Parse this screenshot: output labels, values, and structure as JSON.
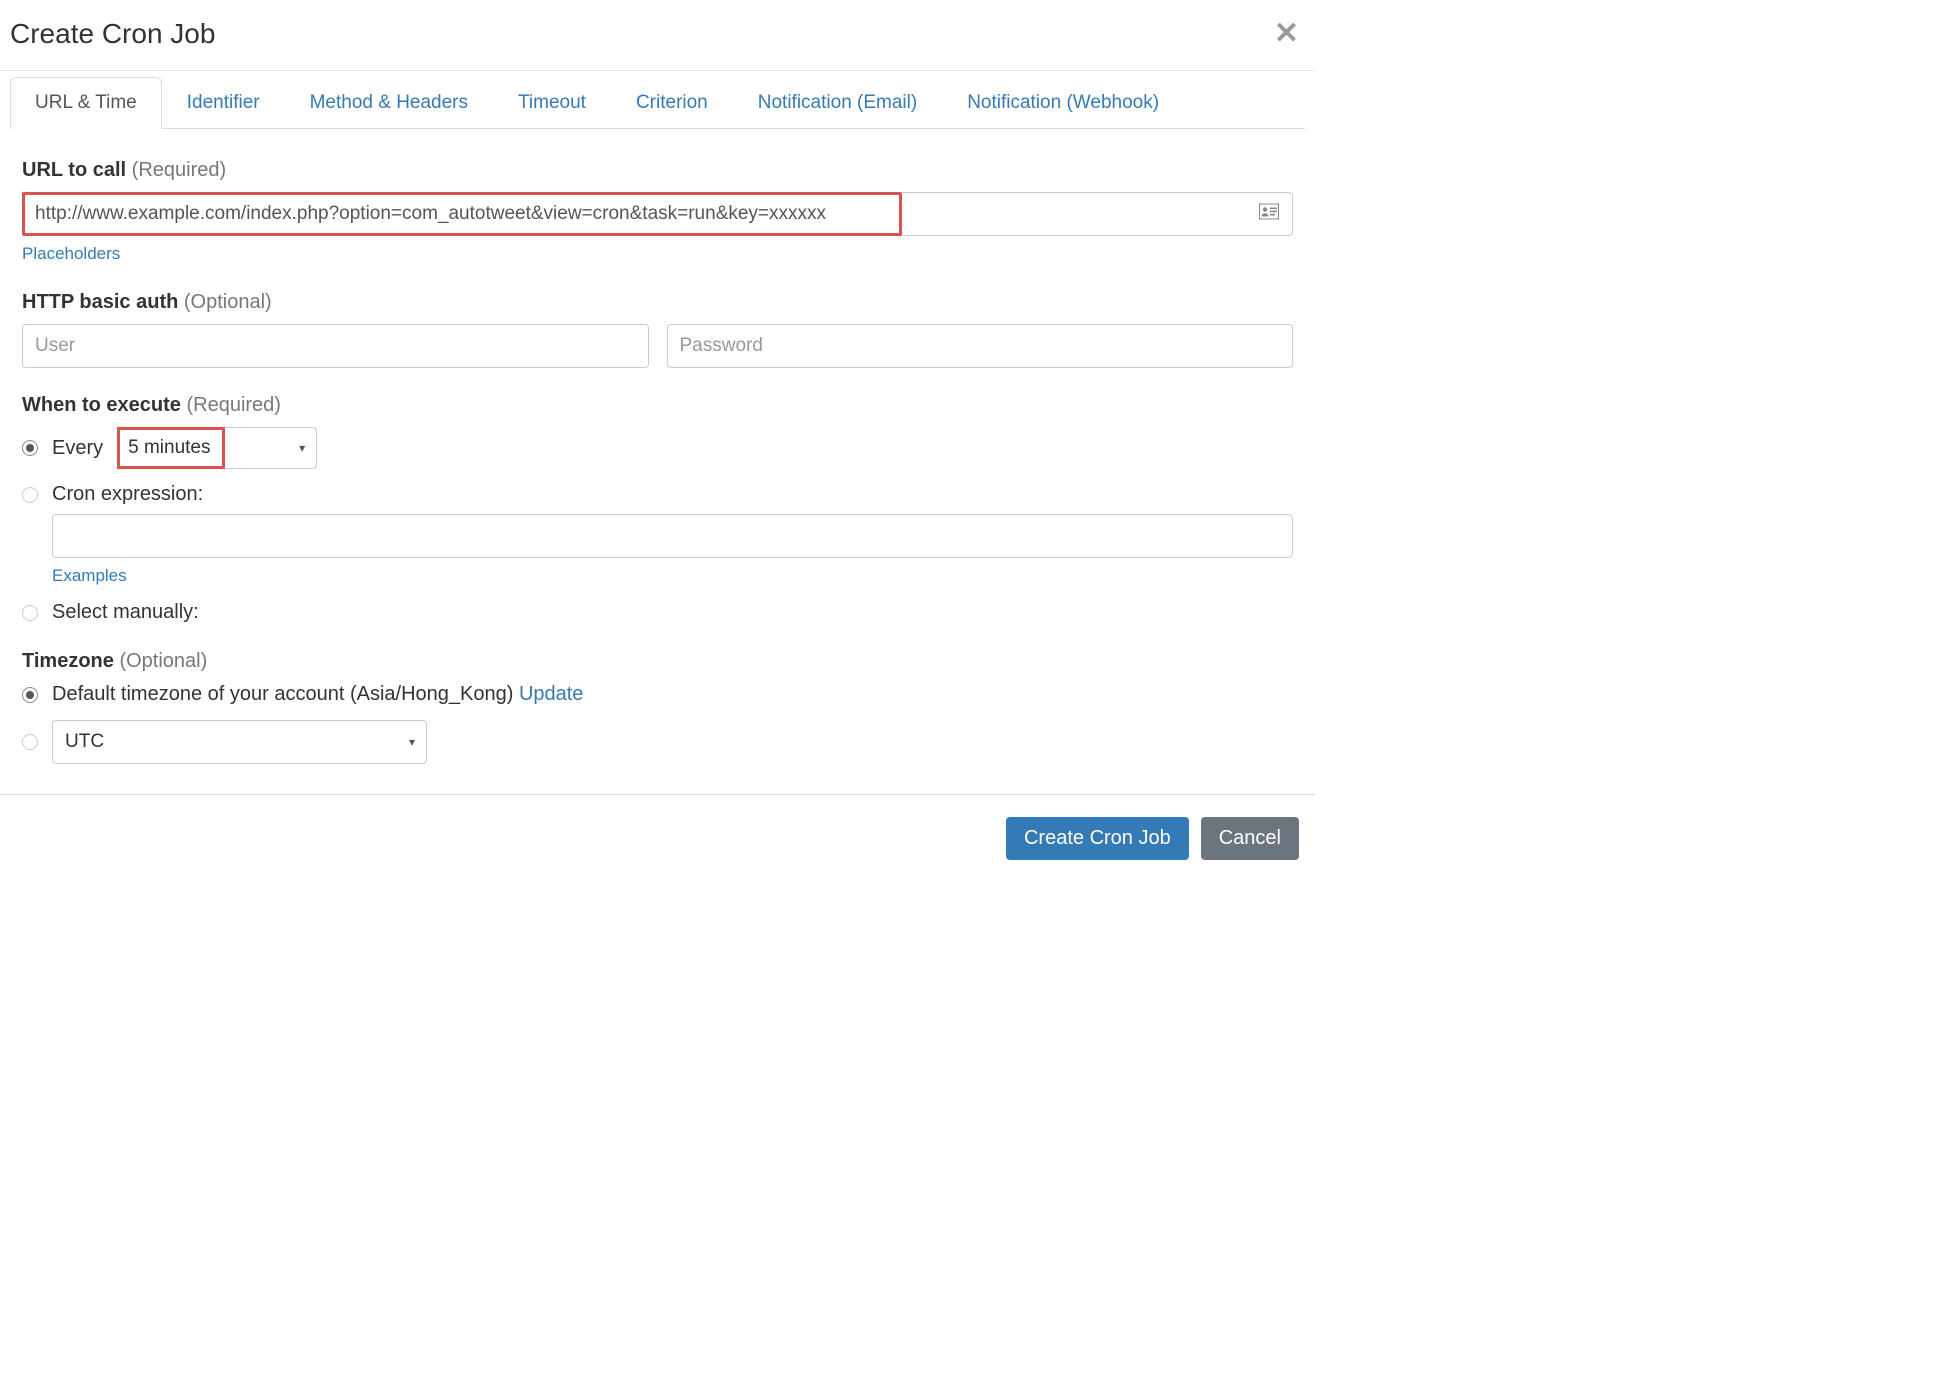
{
  "header": {
    "title": "Create Cron Job"
  },
  "tabs": [
    {
      "label": "URL & Time",
      "active": true
    },
    {
      "label": "Identifier"
    },
    {
      "label": "Method & Headers"
    },
    {
      "label": "Timeout"
    },
    {
      "label": "Criterion"
    },
    {
      "label": "Notification (Email)"
    },
    {
      "label": "Notification (Webhook)"
    }
  ],
  "url_section": {
    "label": "URL to call",
    "required": "(Required)",
    "value": "http://www.example.com/index.php?option=com_autotweet&view=cron&task=run&key=xxxxxx",
    "placeholders_link": "Placeholders"
  },
  "auth_section": {
    "label": "HTTP basic auth",
    "optional": "(Optional)",
    "user_placeholder": "User",
    "password_placeholder": "Password"
  },
  "execute_section": {
    "label": "When to execute",
    "required": "(Required)",
    "every_label": "Every",
    "interval_value": "5 minutes",
    "cron_label": "Cron expression:",
    "cron_value": "",
    "examples_link": "Examples",
    "manual_label": "Select manually:"
  },
  "timezone_section": {
    "label": "Timezone",
    "optional": "(Optional)",
    "default_label_prefix": "Default timezone of your account (",
    "default_tz": "Asia/Hong_Kong",
    "default_label_suffix": ") ",
    "update_link": "Update",
    "custom_value": "UTC"
  },
  "footer": {
    "submit": "Create Cron Job",
    "cancel": "Cancel"
  }
}
